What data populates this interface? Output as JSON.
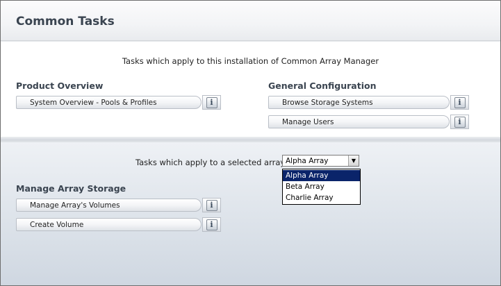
{
  "header": {
    "title": "Common Tasks"
  },
  "install_section": {
    "intro": "Tasks which apply to this installation of Common Array Manager",
    "groups": [
      {
        "title": "Product Overview",
        "tasks": [
          {
            "label": "System Overview - Pools & Profiles"
          }
        ]
      },
      {
        "title": "General Configuration",
        "tasks": [
          {
            "label": "Browse Storage Systems"
          },
          {
            "label": "Manage Users"
          }
        ]
      }
    ]
  },
  "array_section": {
    "selector_label": "Tasks which apply to a selected array:",
    "selected_array": "Alpha Array",
    "options": [
      "Alpha Array",
      "Beta Array",
      "Charlie Array"
    ],
    "highlighted_option": "Alpha Array",
    "group": {
      "title": "Manage Array Storage",
      "tasks": [
        {
          "label": "Manage Array's Volumes"
        },
        {
          "label": "Create Volume"
        }
      ]
    }
  },
  "icons": {
    "info": "i",
    "dropdown_arrow": "▼"
  },
  "colors": {
    "title_text": "#3a4450",
    "dropdown_highlight": "#0a246a",
    "section_gradient_bottom": "#cfd7e1"
  }
}
